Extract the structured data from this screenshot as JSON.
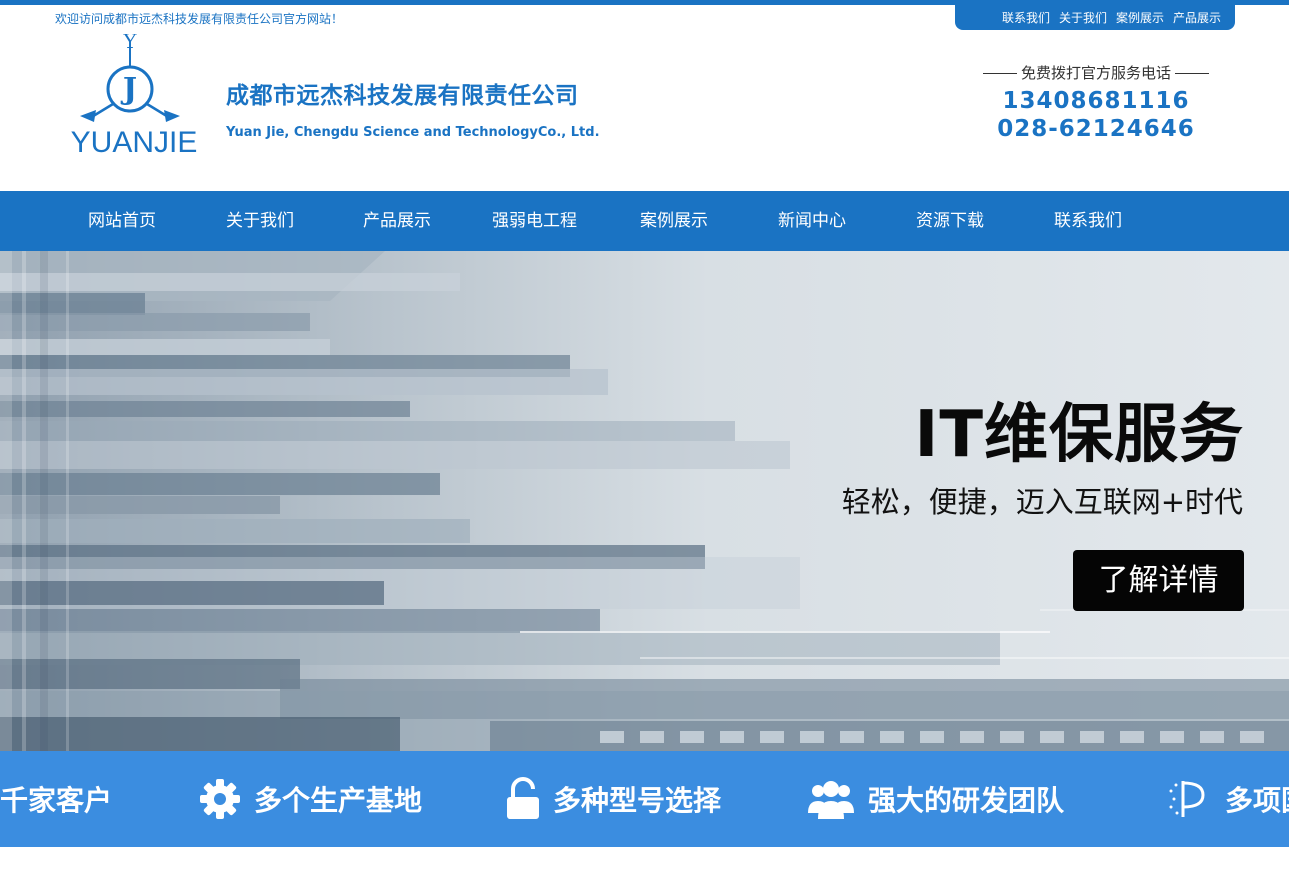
{
  "header": {
    "welcome": "欢迎访问成都市远杰科技发展有限责任公司官方网站！",
    "top_links": [
      "联系我们",
      "关于我们",
      "案例展示",
      "产品展示"
    ],
    "logo": {
      "text": "YUANJIE",
      "mark_letters": [
        "Y",
        "J"
      ]
    },
    "company_cn": "成都市远杰科技发展有限责任公司",
    "company_en": "Yuan Jie, Chengdu Science and TechnologyCo., Ltd.",
    "hotline_title": "免费拨打官方服务电话",
    "phones": [
      "13408681116",
      "028-62124646"
    ]
  },
  "nav": {
    "items": [
      "网站首页",
      "关于我们",
      "产品展示",
      "强弱电工程",
      "案例展示",
      "新闻中心",
      "资源下载",
      "联系我们"
    ]
  },
  "banner": {
    "title": "IT维保服务",
    "subtitle": "轻松，便捷，迈入互联网+时代",
    "button": "了解详情"
  },
  "features": {
    "items": [
      {
        "label": "上千家客户",
        "icon": "customers-icon"
      },
      {
        "label": "多个生产基地",
        "icon": "gear-icon"
      },
      {
        "label": "多种型号选择",
        "icon": "unlock-icon"
      },
      {
        "label": "强大的研发团队",
        "icon": "team-icon"
      },
      {
        "label": "多项国",
        "icon": "certificate-icon"
      }
    ]
  },
  "colors": {
    "brand_blue": "#1a73c3",
    "feature_blue": "#3b8de0",
    "button_black": "#050505"
  }
}
